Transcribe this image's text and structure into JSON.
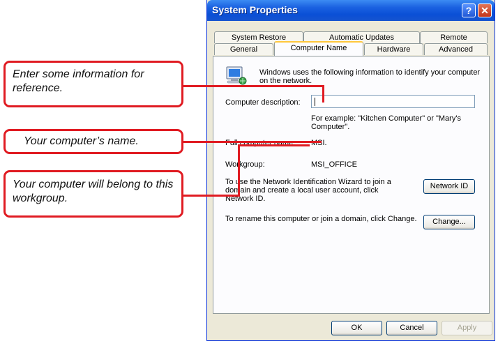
{
  "callouts": {
    "description": "Enter some information for reference.",
    "computer_name": "Your computer’s name.",
    "workgroup": "Your computer will belong to this workgroup."
  },
  "window": {
    "title": "System Properties",
    "help_glyph": "?",
    "close_glyph": "✕"
  },
  "tabs": {
    "row1": [
      "System Restore",
      "Automatic Updates",
      "Remote"
    ],
    "row2": [
      "General",
      "Computer Name",
      "Hardware",
      "Advanced"
    ],
    "active": "Computer Name"
  },
  "content": {
    "intro": "Windows uses the following information to identify your computer on the network.",
    "description_label": "Computer description:",
    "description_value": "",
    "example": "For example: \"Kitchen Computer\" or \"Mary's Computer\".",
    "full_name_label": "Full computer name:",
    "full_name_value": "MSI.",
    "workgroup_label": "Workgroup:",
    "workgroup_value": "MSI_OFFICE",
    "network_id_text": "To use the Network Identification Wizard to join a domain and create a local user account, click Network ID.",
    "network_id_button": "Network ID",
    "change_text": "To rename this computer or join a domain, click Change.",
    "change_button": "Change..."
  },
  "footer": {
    "ok": "OK",
    "cancel": "Cancel",
    "apply": "Apply"
  },
  "icons": [
    "computer-network-icon",
    "help-icon",
    "close-icon"
  ],
  "colors": {
    "callout_border": "#e01b22",
    "titlebar": "#0a4fd6",
    "window_bg": "#ece9d8",
    "active_tab_highlight": "#ffc83c"
  }
}
